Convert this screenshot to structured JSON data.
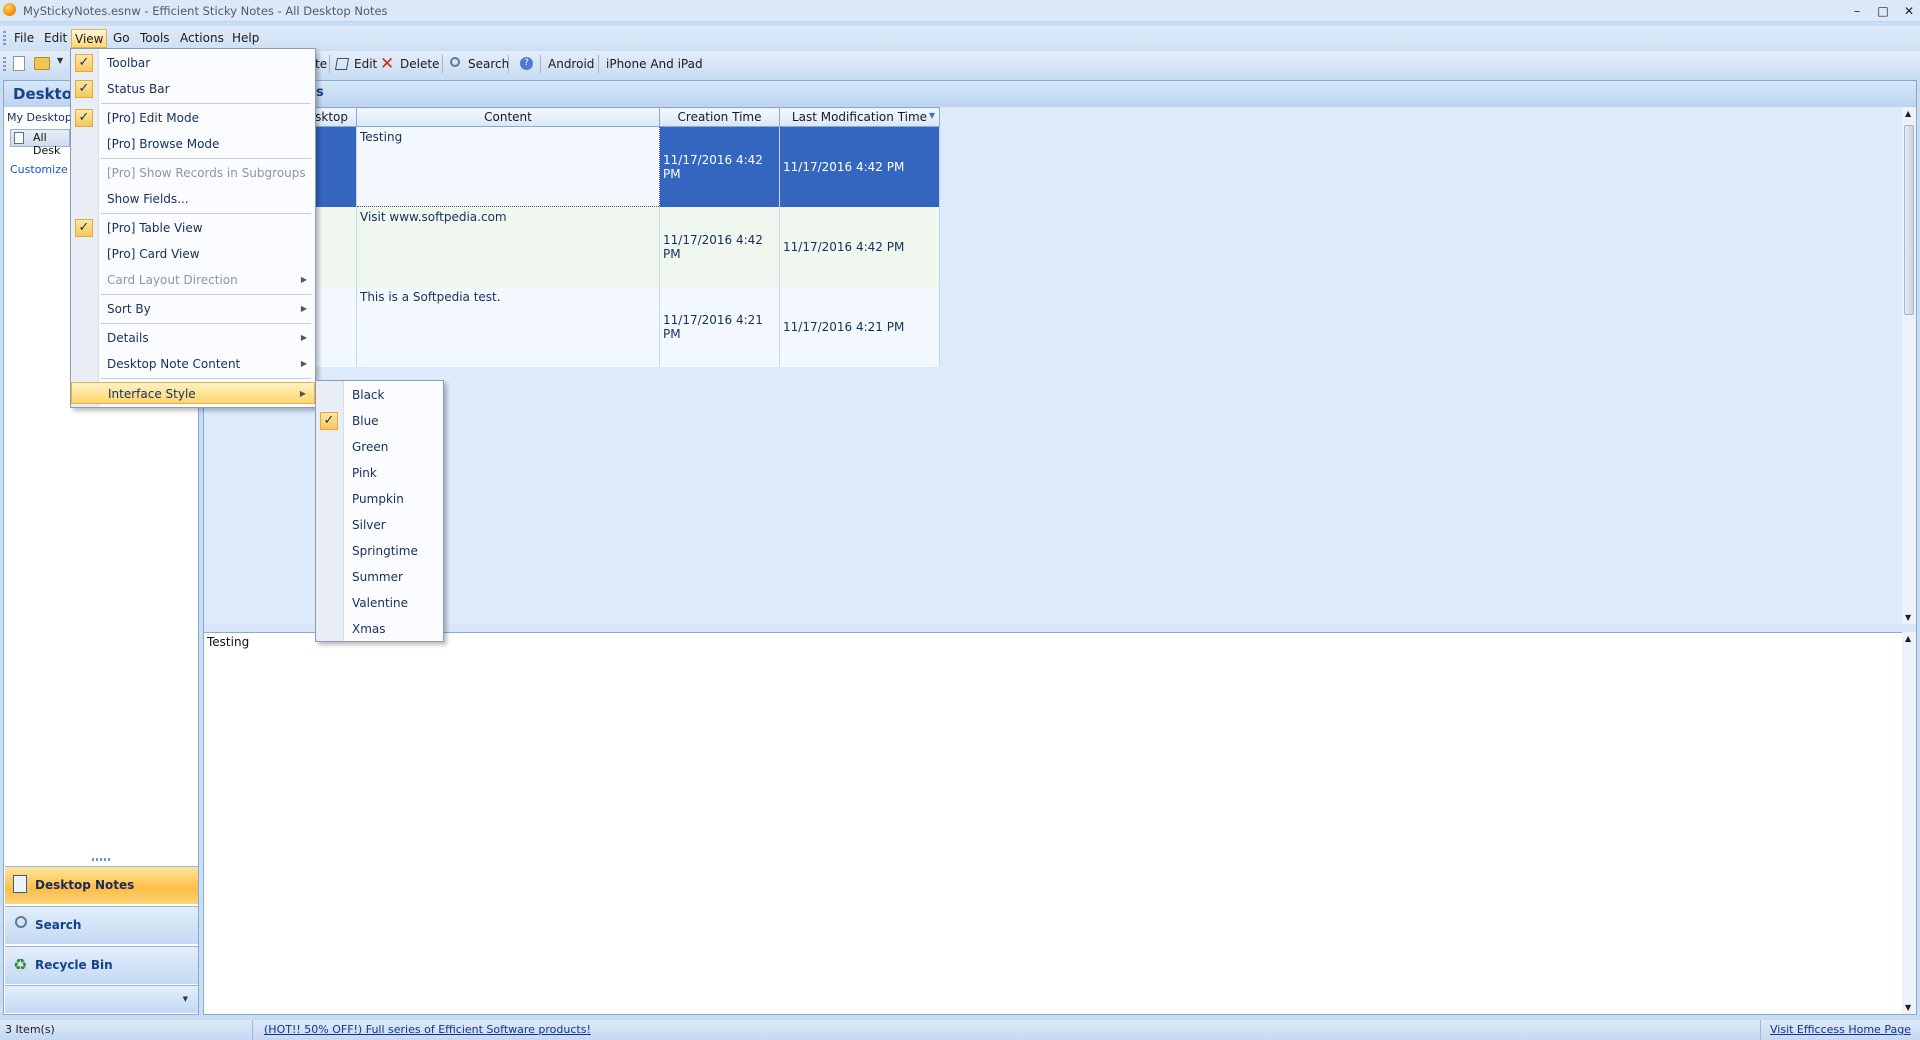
{
  "window": {
    "title": "MyStickyNotes.esnw - Efficient Sticky Notes - All Desktop Notes",
    "minimize_glyph": "–",
    "maximize_glyph": "□",
    "close_glyph": "✕"
  },
  "menubar": [
    "File",
    "Edit",
    "View",
    "Go",
    "Tools",
    "Actions",
    "Help"
  ],
  "toolbar": {
    "delete_prefix": "te",
    "edit": "Edit",
    "delete": "Delete",
    "search": "Search",
    "android": "Android",
    "iphone": "iPhone And iPad"
  },
  "left_pane": {
    "header": "Desktop",
    "tree_root": "My Desktop N",
    "tree_item": "All Desk",
    "customize": "Customize C",
    "nav": [
      {
        "label": "Desktop Notes",
        "icon": "sticky-note-icon"
      },
      {
        "label": "Search",
        "icon": "magnifier-icon"
      },
      {
        "label": "Recycle Bin",
        "icon": "recycle-bin-icon"
      }
    ]
  },
  "content": {
    "title_fragment": "s",
    "columns": [
      "sktop",
      "Content",
      "Creation Time",
      "Last Modification Time"
    ],
    "rows": [
      {
        "content": "Testing",
        "created": "11/17/2016 4:42 PM",
        "modified": "11/17/2016 4:42 PM"
      },
      {
        "content": "Visit www.softpedia.com",
        "created": "11/17/2016 4:42 PM",
        "modified": "11/17/2016 4:42 PM"
      },
      {
        "content": "This is a Softpedia test.",
        "created": "11/17/2016 4:21 PM",
        "modified": "11/17/2016 4:21 PM"
      }
    ],
    "preview_text": "Testing"
  },
  "view_menu": {
    "items": [
      {
        "label": "Toolbar",
        "checked": true
      },
      {
        "label": "Status Bar",
        "checked": true
      },
      {
        "label": "[Pro] Edit Mode",
        "checked": true
      },
      {
        "label": "[Pro] Browse Mode"
      },
      {
        "label": "[Pro] Show Records in Subgroups",
        "disabled": true
      },
      {
        "label": "Show Fields..."
      },
      {
        "label": "[Pro] Table View",
        "checked": true
      },
      {
        "label": "[Pro] Card View"
      },
      {
        "label": "Card Layout Direction",
        "disabled": true,
        "submenu": true
      },
      {
        "label": "Sort By",
        "submenu": true
      },
      {
        "label": "Details",
        "submenu": true
      },
      {
        "label": "Desktop Note Content",
        "submenu": true
      },
      {
        "label": "Interface Style",
        "submenu": true,
        "highlighted": true
      }
    ]
  },
  "style_menu": {
    "items": [
      "Black",
      "Blue",
      "Green",
      "Pink",
      "Pumpkin",
      "Silver",
      "Springtime",
      "Summer",
      "Valentine",
      "Xmas"
    ],
    "checked": "Blue"
  },
  "status": {
    "items": "3 Item(s)",
    "promo": "(HOT!! 50% OFF!) Full series of Efficient Software products!",
    "home": "Visit Efficcess Home Page"
  },
  "colors": {
    "selection": "#3466c0",
    "menu_highlight": "#ffd66b",
    "nav_active": "#fcbe48"
  }
}
